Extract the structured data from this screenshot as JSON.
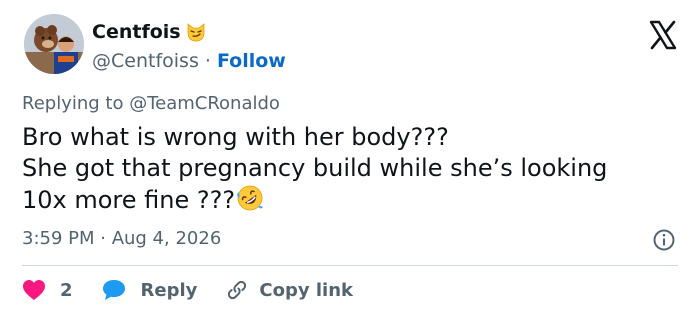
{
  "author": {
    "display_name": "Centfois",
    "handle": "@Centfoiss",
    "separator": " · ",
    "follow_label": "Follow",
    "badge_emoji": "smirking-cat-face"
  },
  "reply": {
    "label": "Replying to @TeamCRonaldo"
  },
  "tweet": {
    "lines": [
      "Bro what is wrong with her body???",
      "She got that pregnancy build while she’s looking",
      "10x more fine ???"
    ],
    "trailing_emoji": "rolling-on-floor-laughing"
  },
  "meta": {
    "timestamp": "3:59 PM · Aug 4, 2026"
  },
  "actions": {
    "like_count": "2",
    "reply_label": "Reply",
    "copy_label": "Copy link"
  },
  "colors": {
    "text": "#0f1419",
    "secondary": "#536471",
    "link": "#0b69c7",
    "like": "#f91880",
    "reply_bubble": "#1d9bf0",
    "divider": "#cfd9de"
  },
  "icons": {
    "brand": "x-logo-icon",
    "info": "info-icon",
    "like": "heart-icon",
    "reply": "speech-bubble-icon",
    "copy": "link-icon"
  }
}
